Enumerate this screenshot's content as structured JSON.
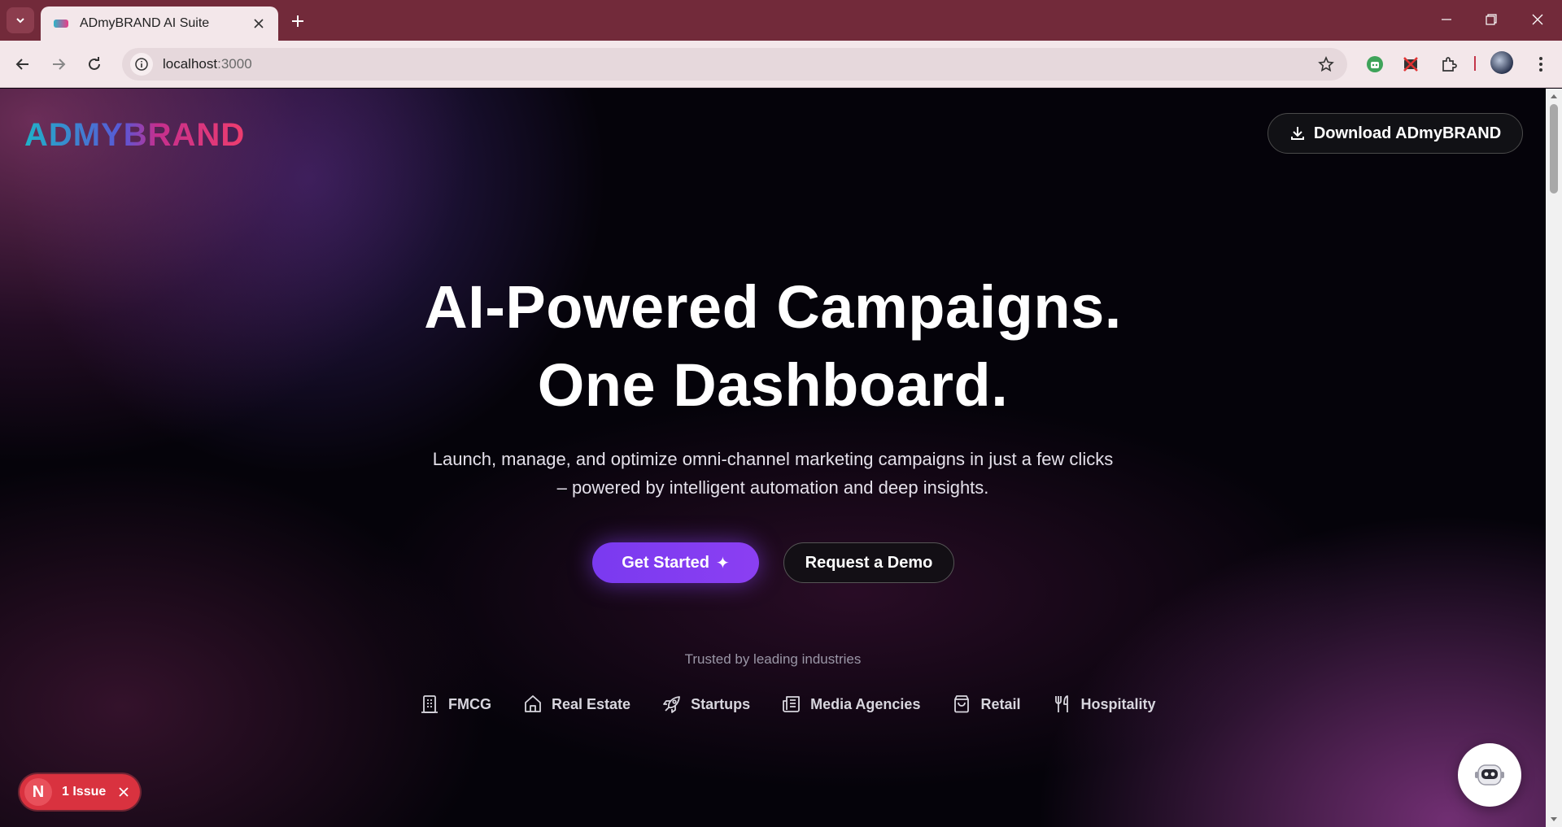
{
  "browser": {
    "tab_title": "ADmyBRAND AI Suite",
    "url_host": "localhost",
    "url_port": ":3000"
  },
  "header": {
    "logo_text": "ADMYBRAND",
    "download_label": "Download ADmyBRAND"
  },
  "hero": {
    "title_line1": "AI-Powered Campaigns.",
    "title_line2": "One Dashboard.",
    "subtitle": "Launch, manage, and optimize omni-channel marketing campaigns in just a few clicks – powered by intelligent automation and deep insights.",
    "primary_cta": "Get Started",
    "primary_cta_icon": "✦",
    "secondary_cta": "Request a Demo"
  },
  "trusted": {
    "label": "Trusted by leading industries",
    "industries": [
      {
        "label": "FMCG",
        "icon": "building-icon"
      },
      {
        "label": "Real Estate",
        "icon": "house-icon"
      },
      {
        "label": "Startups",
        "icon": "rocket-icon"
      },
      {
        "label": "Media Agencies",
        "icon": "newspaper-icon"
      },
      {
        "label": "Retail",
        "icon": "shopping-bag-icon"
      },
      {
        "label": "Hospitality",
        "icon": "utensils-icon"
      }
    ]
  },
  "dev_overlay": {
    "badge_letter": "N",
    "issue_text": "1 Issue"
  },
  "colors": {
    "tabstrip": "#722a3a",
    "primary": "#7a3af0",
    "issue_red": "#d9323f"
  }
}
